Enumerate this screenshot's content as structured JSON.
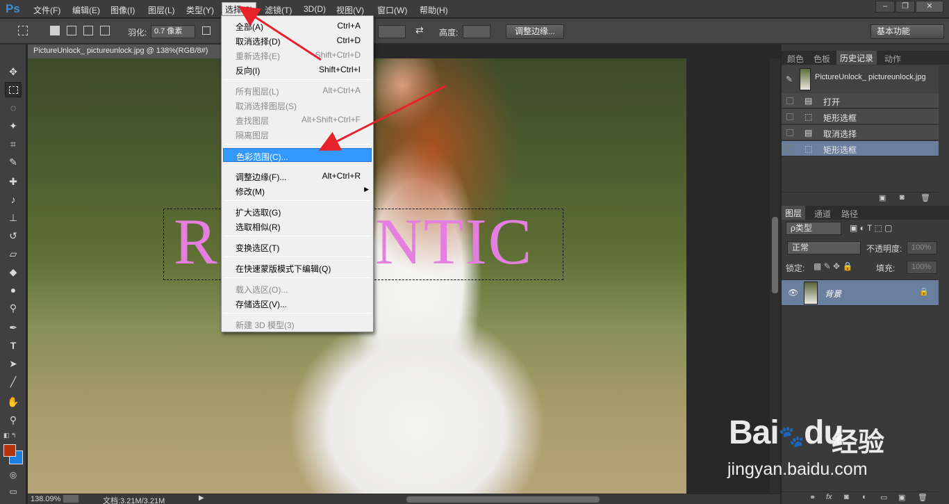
{
  "app": {
    "logo": "Ps"
  },
  "menubar": {
    "items": [
      "文件(F)",
      "编辑(E)",
      "图像(I)",
      "图层(L)",
      "类型(Y)",
      "选择(S)",
      "滤镜(T)",
      "3D(D)",
      "视图(V)",
      "窗口(W)",
      "帮助(H)"
    ],
    "window_buttons": [
      "–",
      "❐",
      "✕"
    ]
  },
  "options": {
    "feather_label": "羽化:",
    "feather_value": "0.7 像素",
    "height_label": "高度:",
    "refine_button": "调整边缘...",
    "workspace": "基本功能"
  },
  "document": {
    "tab_title": "PictureUnlock_ pictureunlock.jpg @ 138%(RGB/8#)",
    "canvas_text": "ROMANTIC",
    "zoom": "138.09%",
    "doc_info": "文档:3.21M/3.21M"
  },
  "select_menu": {
    "items": [
      {
        "label": "全部(A)",
        "shortcut": "Ctrl+A",
        "enabled": true
      },
      {
        "label": "取消选择(D)",
        "shortcut": "Ctrl+D",
        "enabled": true
      },
      {
        "label": "重新选择(E)",
        "shortcut": "Shift+Ctrl+D",
        "enabled": false
      },
      {
        "label": "反向(I)",
        "shortcut": "Shift+Ctrl+I",
        "enabled": true
      },
      {
        "label": "所有图层(L)",
        "shortcut": "Alt+Ctrl+A",
        "enabled": false
      },
      {
        "label": "取消选择图层(S)",
        "shortcut": "",
        "enabled": false
      },
      {
        "label": "查找图层",
        "shortcut": "Alt+Shift+Ctrl+F",
        "enabled": false
      },
      {
        "label": "隔离图层",
        "shortcut": "",
        "enabled": false
      },
      {
        "label": "色彩范围(C)...",
        "shortcut": "",
        "enabled": true,
        "highlighted": true
      },
      {
        "label": "调整边缘(F)...",
        "shortcut": "Alt+Ctrl+R",
        "enabled": true
      },
      {
        "label": "修改(M)",
        "shortcut": "",
        "enabled": true,
        "submenu": true
      },
      {
        "label": "扩大选取(G)",
        "shortcut": "",
        "enabled": true
      },
      {
        "label": "选取相似(R)",
        "shortcut": "",
        "enabled": true
      },
      {
        "label": "变换选区(T)",
        "shortcut": "",
        "enabled": true
      },
      {
        "label": "在快速蒙版模式下编辑(Q)",
        "shortcut": "",
        "enabled": true
      },
      {
        "label": "载入选区(O)...",
        "shortcut": "",
        "enabled": false
      },
      {
        "label": "存储选区(V)...",
        "shortcut": "",
        "enabled": true
      },
      {
        "label": "新建 3D 模型(3)",
        "shortcut": "",
        "enabled": false
      }
    ]
  },
  "history_panel": {
    "tabs": [
      "颜色",
      "色板",
      "历史记录",
      "动作"
    ],
    "snapshot": "PictureUnlock_ pictureunlock.jpg",
    "states": [
      "打开",
      "矩形选框",
      "取消选择",
      "矩形选框"
    ]
  },
  "layers_panel": {
    "tabs": [
      "图层",
      "通道",
      "路径"
    ],
    "filter": "ρ类型",
    "blend_mode": "正常",
    "opacity_label": "不透明度:",
    "opacity_value": "100%",
    "lock_label": "锁定:",
    "fill_label": "填充:",
    "fill_value": "100%",
    "layers": [
      {
        "name": "背景"
      }
    ]
  },
  "watermark": {
    "logo": "Bai",
    "logo2": "du",
    "brand": "经验",
    "url": "jingyan.baidu.com"
  },
  "colors": {
    "foreground": "#b5320e",
    "background": "#1a7fe0",
    "highlight": "#3399ff",
    "text_pink": "#e47fe0",
    "arrow": "#e8222b"
  }
}
